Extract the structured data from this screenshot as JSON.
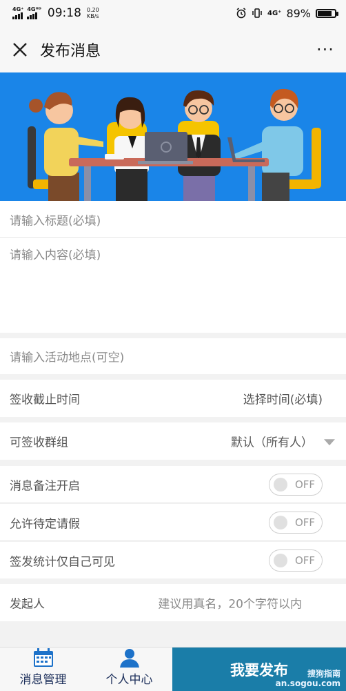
{
  "status_bar": {
    "signal1": "4G⁺",
    "signal2": "4Gᴴᴰ",
    "time": "09:18",
    "net_speed_value": "0.20",
    "net_speed_unit": "KB/s",
    "net_type": "4G⁺",
    "battery_percent": "89%",
    "battery_level": 0.89
  },
  "title_bar": {
    "title": "发布消息",
    "close_icon": "close-icon",
    "more_icon": "more-icon",
    "more_glyph": "···"
  },
  "form": {
    "title_placeholder": "请输入标题(必填)",
    "content_placeholder": "请输入内容(必填)",
    "location_placeholder": "请输入活动地点(可空)",
    "deadline_label": "签收截止时间",
    "deadline_value": "选择时间(必填)",
    "group_label": "可签收群组",
    "group_value": "默认（所有人）",
    "remark_label": "消息备注开启",
    "remark_toggle": "OFF",
    "leave_label": "允许待定请假",
    "leave_toggle": "OFF",
    "stats_label": "签发统计仅自己可见",
    "stats_toggle": "OFF",
    "sender_label": "发起人",
    "sender_placeholder": "建议用真名，20个字符以内"
  },
  "bottom_nav": {
    "tab1_label": "消息管理",
    "tab2_label": "个人中心",
    "publish_label": "我要发布",
    "watermark_line1": "搜狗指南",
    "watermark_line2": "an.sogou.com"
  },
  "colors": {
    "banner": "#1a85e8",
    "publish": "#1a7da8",
    "tab_icon": "#1d72c9"
  }
}
